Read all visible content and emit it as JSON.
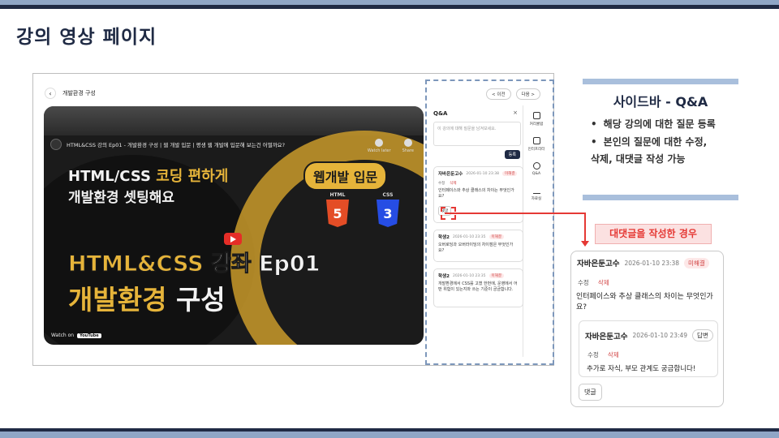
{
  "slide": {
    "title": "강의 영상 페이지"
  },
  "frame": {
    "back_icon": "chevron-left-icon",
    "header_title": "개발환경 구성",
    "video": {
      "yt_title": "HTML&CSS 강의 Ep01 - 개발환경 구성 | 웹 개발 입문 | 평생 웹 개발에 입문해 보는건 어떨까요?",
      "watch_later": "Watch later",
      "share": "Share",
      "headline_1a": "HTML/CSS ",
      "headline_1b": "코딩 편하게",
      "headline_2": "개발환경 셋팅해요",
      "badge": "웹개발 입문",
      "html_label": "HTML",
      "html_num": "5",
      "css_label": "CSS",
      "css_num": "3",
      "headline_3a": "HTML&CSS ",
      "headline_3b": "강좌 Ep01",
      "headline_4a": "개발환경 ",
      "headline_4b": "구성",
      "watch_on": "Watch on",
      "youtube": "YouTube"
    },
    "sidebar": {
      "prev": "< 이전",
      "next": "다음 >",
      "qa_title": "Q&A",
      "close": "×",
      "input_placeholder": "이 강의에 대해 질문을 남겨보세요.",
      "submit": "등록",
      "questions": [
        {
          "name": "자바은둔고수",
          "time": "2026-01-10 23:38",
          "status": "미해결",
          "edit": "수정",
          "delete": "삭제",
          "body": "인터페이스와 추상 클래스의 차이는 무엇인가요?",
          "reply": "댓글"
        },
        {
          "name": "학생2",
          "time": "2026-01-10 23:35",
          "status": "미해결",
          "body": "오버로딩과 오버라이딩의 차이점은 무엇인가요?"
        },
        {
          "name": "학생2",
          "time": "2026-01-10 23:35",
          "status": "미해결",
          "body": "개발환경에서 CSS를 고쳤 한번에, 운영에서 어떤 위험이 있는지와 쓰는 기준이 궁금합니다."
        }
      ],
      "tools": [
        {
          "label": "커리큘럼",
          "icon": "list-icon"
        },
        {
          "label": "인터프리터",
          "icon": "code-icon"
        },
        {
          "label": "Q&A",
          "icon": "qa-icon"
        },
        {
          "label": "자료실",
          "icon": "download-icon"
        }
      ]
    }
  },
  "description": {
    "title": "사이드바 - Q&A",
    "items": [
      "해당 강의에 대한 질문 등록",
      "본인의 질문에 대한 수정,",
      "삭제, 대댓글 작성 가능"
    ]
  },
  "case_label": "대댓글을 작성한 경우",
  "zoom": {
    "name": "자바은둔고수",
    "time": "2026-01-10 23:38",
    "status": "미해결",
    "edit": "수정",
    "delete": "삭제",
    "body": "인터페이스와 추상 클래스의 차이는 무엇인가요?",
    "reply": {
      "name": "자바은둔고수",
      "time": "2026-01-10 23:49",
      "tag": "답변",
      "edit": "수정",
      "delete": "삭제",
      "body": "추가로 자식, 부모 관계도 궁금합니다!"
    },
    "reply_button": "댓글"
  },
  "colors": {
    "navy": "#1f2a44",
    "accent_blue": "#a9bfdc",
    "red": "#e53935",
    "gold": "#e6b43a"
  }
}
